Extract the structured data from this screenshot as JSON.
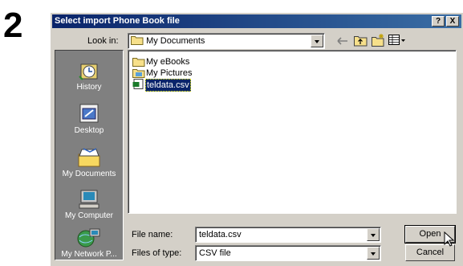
{
  "step_number": "2",
  "dialog": {
    "title": "Select import Phone Book file",
    "help_label": "?",
    "close_label": "X"
  },
  "look_in": {
    "label": "Look in:",
    "value": "My Documents"
  },
  "places": [
    {
      "label": "History",
      "icon": "history-icon"
    },
    {
      "label": "Desktop",
      "icon": "desktop-icon"
    },
    {
      "label": "My Documents",
      "icon": "my-documents-icon"
    },
    {
      "label": "My Computer",
      "icon": "my-computer-icon"
    },
    {
      "label": "My Network P...",
      "icon": "my-network-places-icon"
    }
  ],
  "files": [
    {
      "name": "My eBooks",
      "icon": "folder-icon",
      "selected": false
    },
    {
      "name": "My Pictures",
      "icon": "folder-pictures-icon",
      "selected": false
    },
    {
      "name": "teldata.csv",
      "icon": "csv-file-icon",
      "selected": true
    }
  ],
  "file_name": {
    "label": "File name:",
    "value": "teldata.csv"
  },
  "file_type": {
    "label": "Files of type:",
    "value": "CSV file"
  },
  "buttons": {
    "open": "Open",
    "cancel": "Cancel"
  },
  "colors": {
    "title_start": "#0a246a",
    "title_end": "#3a6ea5",
    "dialog_bg": "#d4d0c8",
    "places_bg": "#808080",
    "selection": "#0a246a"
  }
}
